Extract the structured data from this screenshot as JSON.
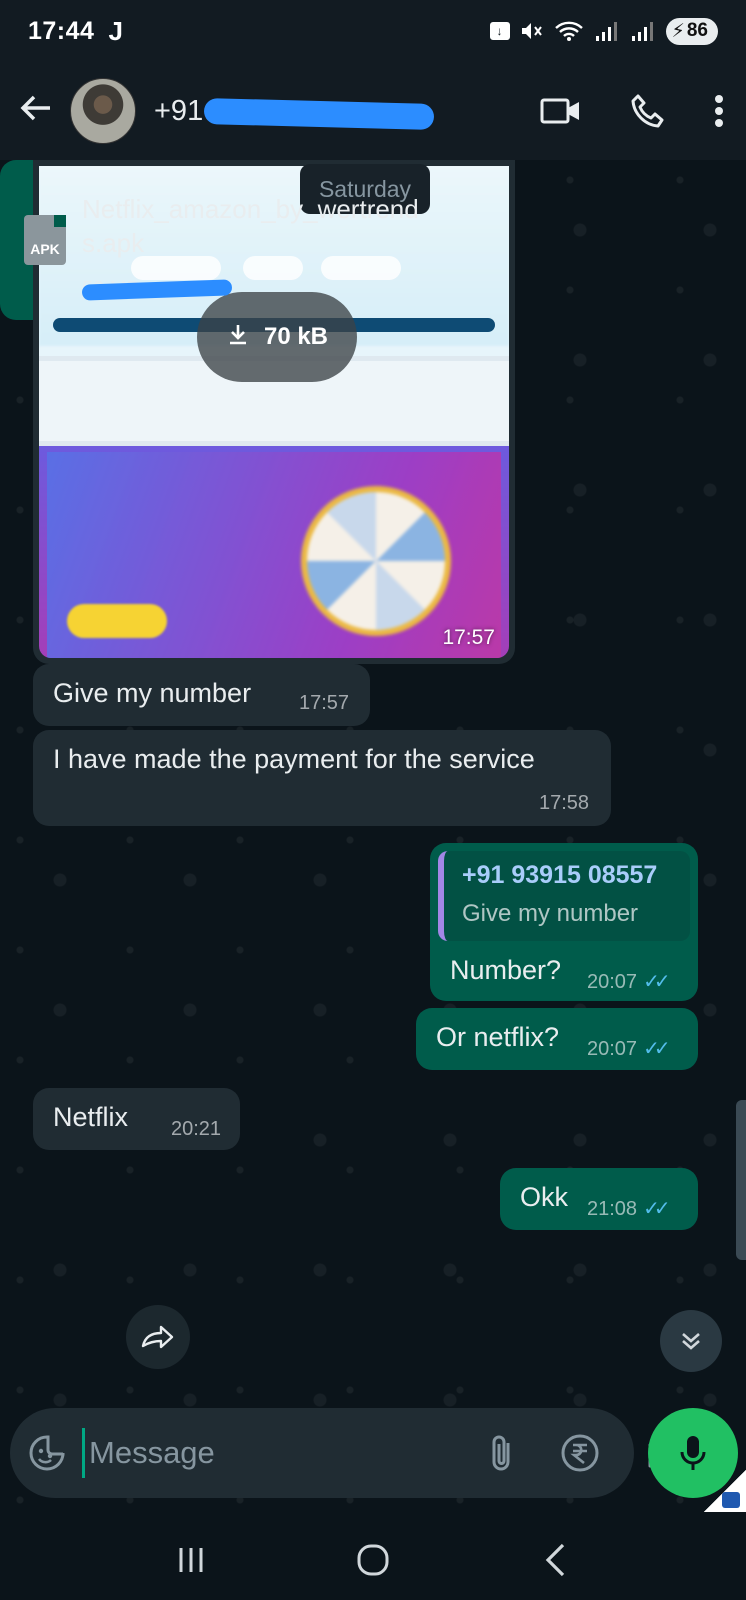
{
  "status_bar": {
    "time": "17:44",
    "carrier_glyph": "J",
    "battery": "86",
    "icons": [
      "notification-icon",
      "mute-icon",
      "wifi-icon",
      "signal-icon",
      "signal-icon",
      "charging-icon"
    ]
  },
  "header": {
    "contact_name": "+91",
    "avatar": "contact-avatar",
    "actions": [
      "video-call-icon",
      "voice-call-icon",
      "more-icon"
    ]
  },
  "chat": {
    "date_chip": "Saturday",
    "image_message": {
      "download_size": "70 kB",
      "time": "17:57"
    },
    "messages": [
      {
        "dir": "in",
        "text": "Give my number",
        "time": "17:57"
      },
      {
        "dir": "in",
        "text": "I have made the payment for the service",
        "time": "17:58"
      },
      {
        "dir": "out",
        "quote_name": "+91 93915 08557",
        "quote_text": "Give my number",
        "text": "Number?",
        "time": "20:07",
        "status": "read"
      },
      {
        "dir": "out",
        "text": "Or netflix?",
        "time": "20:07",
        "status": "read"
      },
      {
        "dir": "in",
        "text": "Netflix",
        "time": "20:21"
      },
      {
        "dir": "out",
        "text": "Okk",
        "time": "21:08",
        "status": "read"
      }
    ],
    "file_message": {
      "file_type": "APK",
      "file_name_line1": "Netflix_amazon_by_wertrend",
      "file_name_line2": "s.apk",
      "file_meta": "52 MB • APK"
    }
  },
  "composer": {
    "placeholder": "Message",
    "icons": [
      "sticker-icon",
      "attach-icon",
      "rupee-payment-icon",
      "camera-icon",
      "mic-icon"
    ]
  },
  "nav": [
    "recents-icon",
    "home-icon",
    "back-nav-icon"
  ],
  "colors": {
    "background": "#0b141a",
    "incoming_bubble": "#202c33",
    "outgoing_bubble": "#005c4b",
    "accent": "#21c063",
    "read_ticks": "#53bdeb"
  }
}
